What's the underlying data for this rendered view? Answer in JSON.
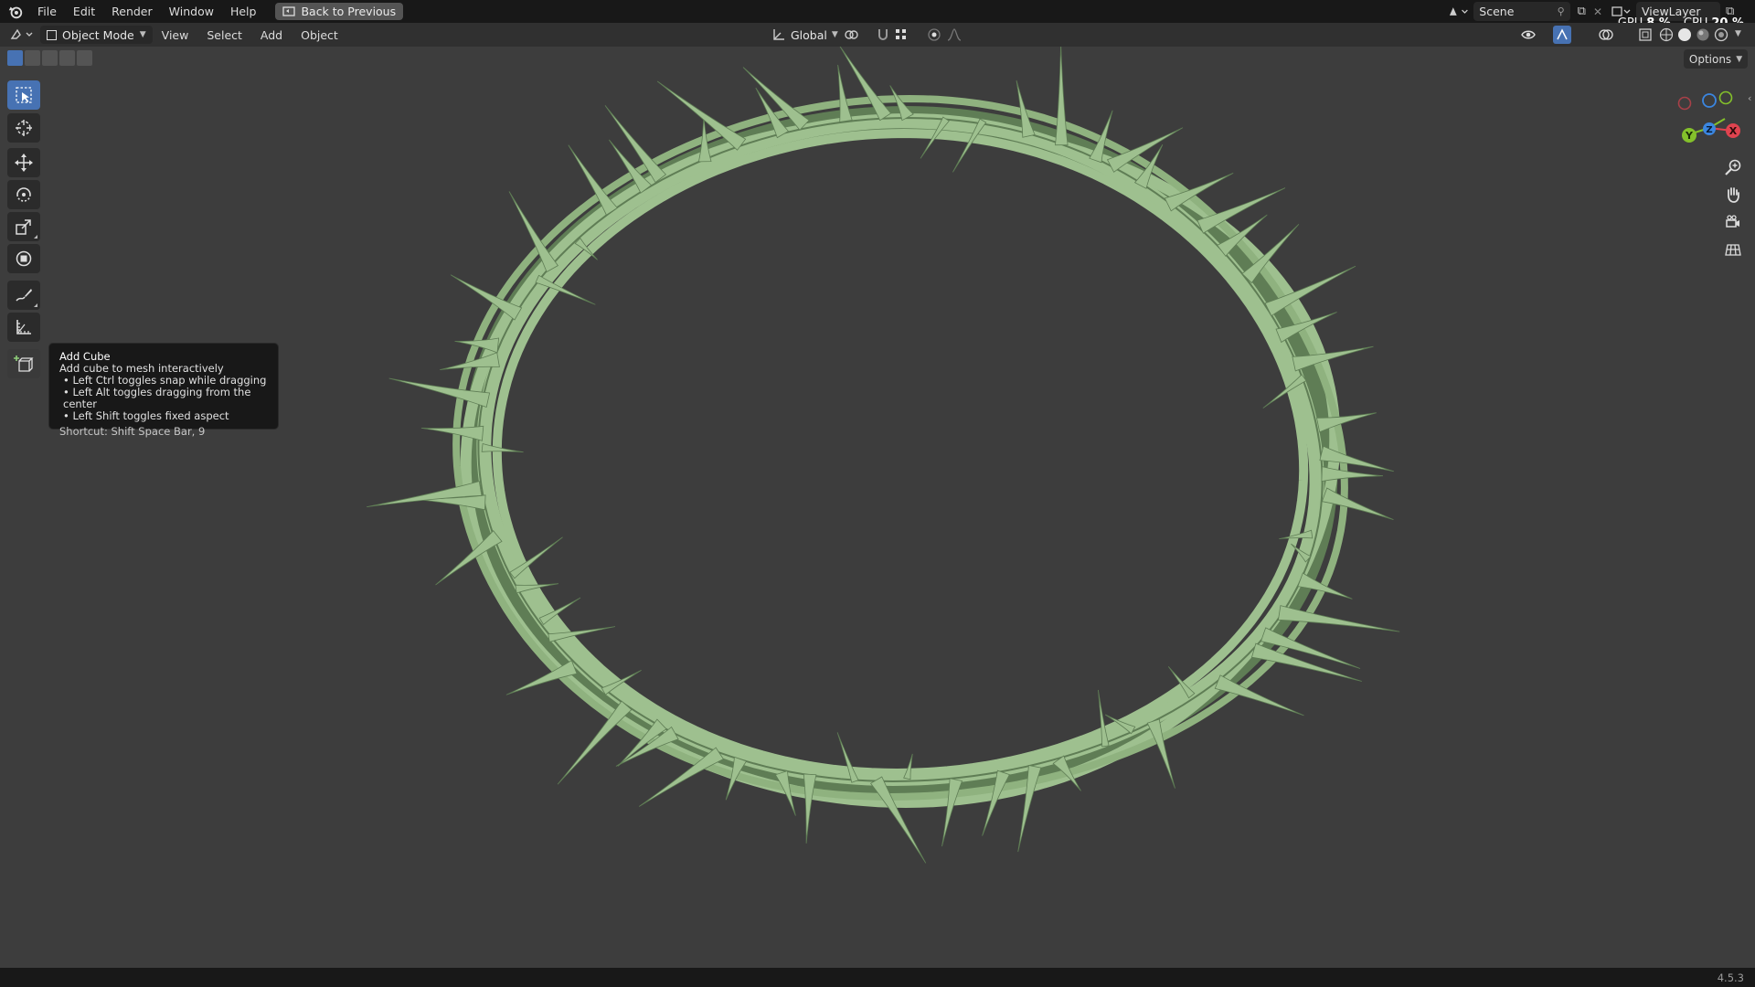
{
  "topbar": {
    "menus": [
      "File",
      "Edit",
      "Render",
      "Window",
      "Help"
    ],
    "back_button": "Back to Previous",
    "scene_name": "Scene",
    "view_layer": "ViewLayer",
    "gpu_label": "GPU",
    "gpu_value": "8 %",
    "cpu_label": "CPU",
    "cpu_value": "20 %"
  },
  "header": {
    "mode": "Object Mode",
    "menus": [
      "View",
      "Select",
      "Add",
      "Object"
    ],
    "transform_orientation": "Global",
    "options_label": "Options"
  },
  "toolbar": {
    "tools": [
      {
        "name": "select-box",
        "icon": "select-box-icon",
        "active": true
      },
      {
        "name": "cursor",
        "icon": "cursor-icon",
        "active": false
      },
      {
        "name": "move",
        "icon": "move-icon",
        "active": false
      },
      {
        "name": "rotate",
        "icon": "rotate-icon",
        "active": false
      },
      {
        "name": "scale",
        "icon": "scale-icon",
        "active": false
      },
      {
        "name": "transform",
        "icon": "transform-icon",
        "active": false
      },
      {
        "name": "annotate",
        "icon": "annotate-icon",
        "active": false
      },
      {
        "name": "measure",
        "icon": "measure-icon",
        "active": false
      },
      {
        "name": "add-cube",
        "icon": "add-cube-icon",
        "active": false
      }
    ]
  },
  "tooltip": {
    "title": "Add Cube",
    "description": "Add cube to mesh interactively",
    "lines": [
      "• Left Ctrl toggles snap while dragging",
      "• Left Alt toggles dragging from the center",
      "• Left Shift toggles fixed aspect"
    ],
    "shortcut": "Shortcut: Shift Space Bar, 9"
  },
  "gizmo": {
    "x_label": "X",
    "y_label": "Y",
    "z_label": "Z",
    "x_color": "#e0434f",
    "y_color": "#84c12b",
    "z_color": "#3b86e0"
  },
  "colors": {
    "mesh": "#9ec08f",
    "mesh_shadow": "#5f7d55",
    "active_tool": "#4772b3",
    "background": "#3d3d3d"
  },
  "statusbar": {
    "version": "4.5.3"
  }
}
